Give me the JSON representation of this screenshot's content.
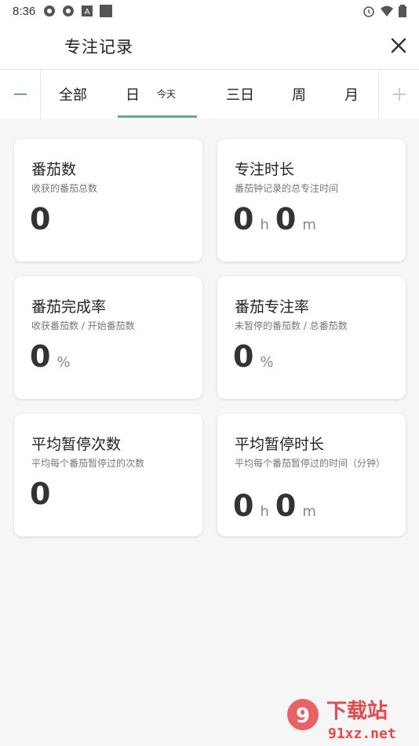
{
  "status": {
    "time": "8:36"
  },
  "header": {
    "title": "专注记录"
  },
  "tabs": {
    "items": [
      "全部",
      "日",
      "三日",
      "周",
      "月"
    ],
    "today_label": "今天"
  },
  "cards": [
    {
      "title": "番茄数",
      "subtitle": "收获的番茄总数",
      "value": "0"
    },
    {
      "title": "专注时长",
      "subtitle": "番茄钟记录的总专注时间",
      "hours": "0",
      "h_unit": "h",
      "minutes": "0",
      "m_unit": "m"
    },
    {
      "title": "番茄完成率",
      "subtitle": "收获番茄数 / 开始番茄数",
      "value": "0",
      "unit": "%"
    },
    {
      "title": "番茄专注率",
      "subtitle": "未暂停的番茄数 / 总番茄数",
      "value": "0",
      "unit": "%"
    },
    {
      "title": "平均暂停次数",
      "subtitle": "平均每个番茄暂停过的次数",
      "value": "0"
    },
    {
      "title": "平均暂停时长",
      "subtitle": "平均每个番茄暂停过的时间（分钟）",
      "hours": "0",
      "h_unit": "h",
      "minutes": "0",
      "m_unit": "m"
    }
  ],
  "watermark": {
    "text1": "下载站",
    "text2": "91xz.net"
  },
  "colors": {
    "accent": "#6ea58f",
    "watermark": "#e8474b"
  }
}
